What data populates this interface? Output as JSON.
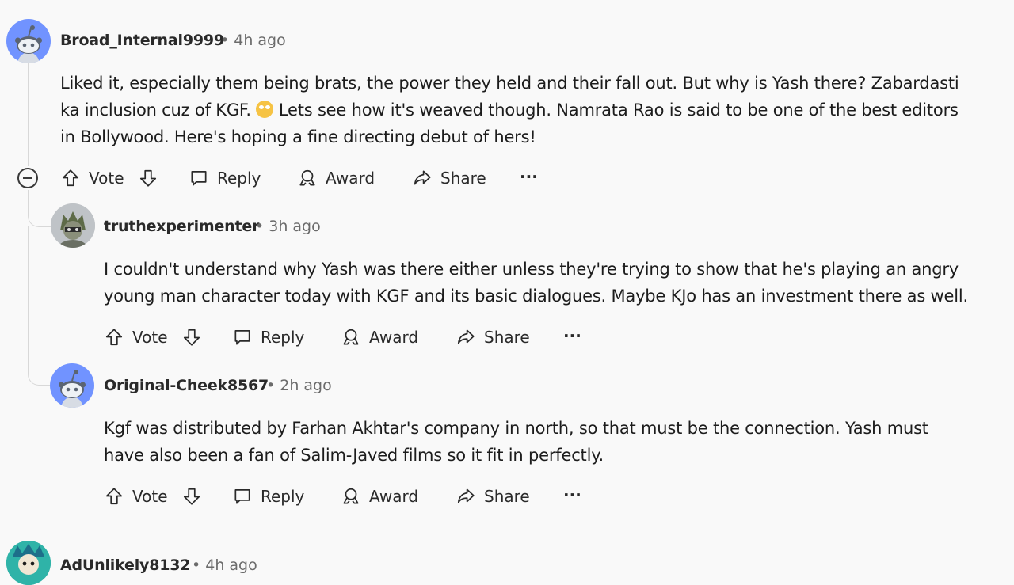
{
  "actions": {
    "vote": "Vote",
    "reply": "Reply",
    "award": "Award",
    "share": "Share",
    "more": "···"
  },
  "comments": [
    {
      "username": "Broad_Internal9999",
      "time": "• 4h ago",
      "avatar": "default-reddit-avatar-icon",
      "lines": [
        "Liked it, especially them being brats, the power they held and their fall out. But why is Yash there? Zabardasti",
        "ka inclusion cuz of KGF.",
        "Lets see how it's weaved though. Namrata Rao is said to be one of the best editors",
        "in Bollywood. Here's hoping a fine directing debut of hers!"
      ],
      "emoji": "rolling-eyes-emoji"
    },
    {
      "username": "truthexperimenter",
      "time": "• 3h ago",
      "avatar": "custom-avatar-icon",
      "lines": [
        "I couldn't understand why Yash was there either unless they're trying to show that he's playing an angry",
        "young man character today with KGF and its basic dialogues. Maybe KJo has an investment there as well."
      ]
    },
    {
      "username": "Original-Cheek8567",
      "time": "• 2h ago",
      "avatar": "default-reddit-avatar-icon",
      "lines": [
        "Kgf was distributed by Farhan Akhtar's company in north, so that must be the connection. Yash must",
        "have also been a fan of Salim-Javed films so it fit in perfectly."
      ]
    },
    {
      "username": "AdUnlikely8132",
      "time": "• 4h ago",
      "avatar": "custom-avatar-icon"
    }
  ]
}
